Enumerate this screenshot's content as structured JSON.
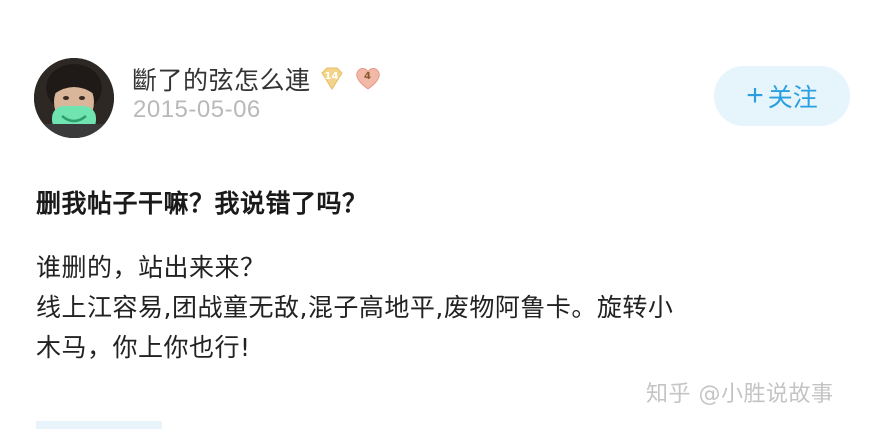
{
  "author": {
    "name": "斷了的弦怎么連",
    "badges": [
      {
        "icon": "diamond-badge-icon",
        "text": "14",
        "color": "#f3d48a"
      },
      {
        "icon": "heart-badge-icon",
        "text": "4",
        "color": "#f2b8a8"
      }
    ],
    "date": "2015-05-06"
  },
  "follow_button": {
    "icon": "plus-icon",
    "plus": "+",
    "label": "关注"
  },
  "post": {
    "title": "删我帖子干嘛？我说错了吗？",
    "lines": [
      "谁删的，站出来来？",
      "线上江容易,团战童无敌,混子高地平,废物阿鲁卡。旋转小",
      "木马，你上你也行!"
    ]
  },
  "watermark": "知乎 @小胜说故事",
  "colors": {
    "accent": "#2a9fe0",
    "follow_bg": "#e6f4fb",
    "date": "#b9b9b9"
  }
}
